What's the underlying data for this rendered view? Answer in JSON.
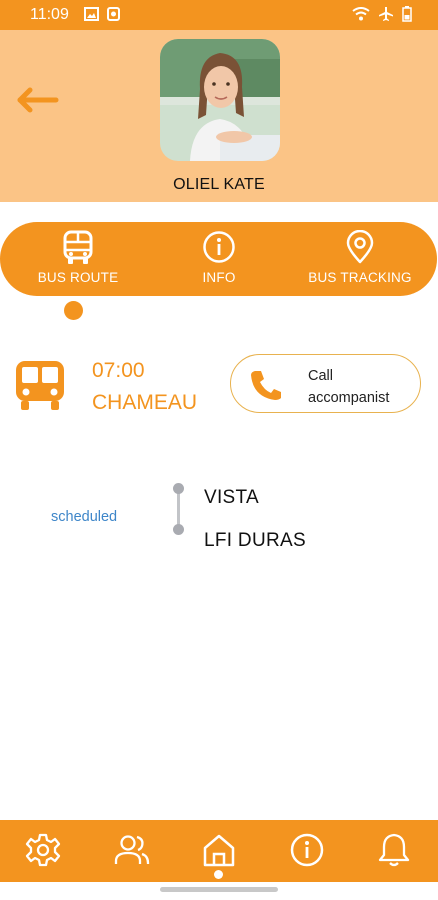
{
  "status_bar": {
    "time": "11:09",
    "left_icons": [
      "image-icon",
      "app-notification-icon"
    ],
    "right_icons": [
      "wifi-icon",
      "airplane-mode-icon",
      "battery-icon"
    ]
  },
  "header": {
    "back_icon": "arrow-left-icon",
    "avatar": "child-photo",
    "child_name": "OLIEL KATE"
  },
  "tabs": [
    {
      "label": "BUS ROUTE",
      "icon": "bus-icon",
      "active": true
    },
    {
      "label": "INFO",
      "icon": "info-icon",
      "active": false
    },
    {
      "label": "BUS TRACKING",
      "icon": "location-pin-icon",
      "active": false
    }
  ],
  "route": {
    "departure_time": "07:00",
    "departure_stop": "CHAMEAU",
    "call_button": {
      "line1": "Call",
      "line2": "accompanist",
      "icon": "phone-icon"
    },
    "status": "scheduled",
    "stops": [
      "VISTA",
      "LFI DURAS"
    ]
  },
  "bottom_nav": {
    "items": [
      "settings-icon",
      "users-icon",
      "home-icon",
      "info-icon",
      "bell-icon"
    ],
    "active_index": 2
  },
  "colors": {
    "primary": "#f3941f",
    "header_bg": "#fbc486",
    "status_link": "#3e86c9",
    "call_border": "#e8b24f"
  }
}
